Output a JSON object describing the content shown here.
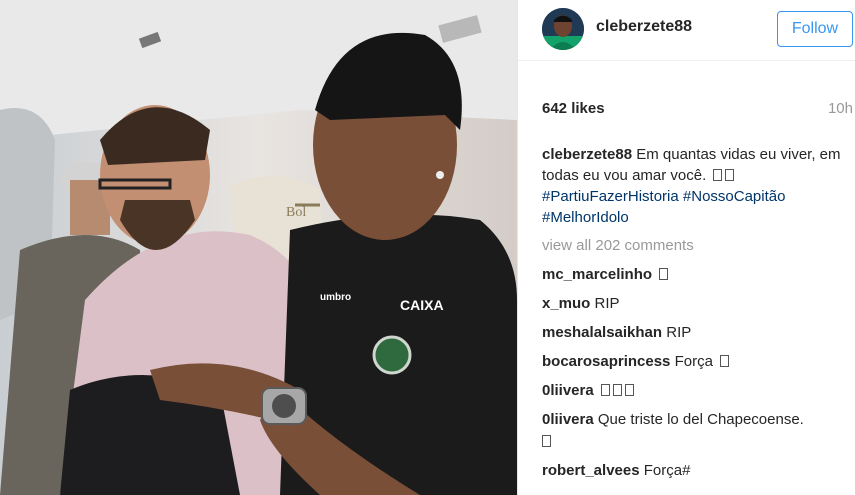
{
  "post": {
    "username": "cleberzete88",
    "follow_label": "Follow",
    "likes": "642 likes",
    "time": "10h",
    "caption": {
      "username": "cleberzete88",
      "text": "Em quantas vidas eu viver, em todas eu vou amar você.",
      "hashtags": [
        "#PartiuFazerHistoria",
        "#NossoCapitão",
        "#MelhorIdolo"
      ]
    },
    "view_all": "view all 202 comments",
    "comments": [
      {
        "user": "mc_marcelinho",
        "text": ""
      },
      {
        "user": "x_muo",
        "text": "RIP"
      },
      {
        "user": "meshalalsaikhan",
        "text": "RIP"
      },
      {
        "user": "bocarosaprincess",
        "text": "Força"
      },
      {
        "user": "0liivera",
        "text": ""
      },
      {
        "user": "0liivera",
        "text": "Que triste lo del Chapecoense."
      },
      {
        "user": "robert_alvees",
        "text": "Força#"
      }
    ]
  },
  "photo": {
    "logos": {
      "shirt_sponsor": "CAIXA",
      "sleeve_brand": "umbro",
      "seat_branding": "Bol"
    }
  },
  "colors": {
    "link": "#003569",
    "follow": "#3897f0",
    "muted": "#999999"
  }
}
